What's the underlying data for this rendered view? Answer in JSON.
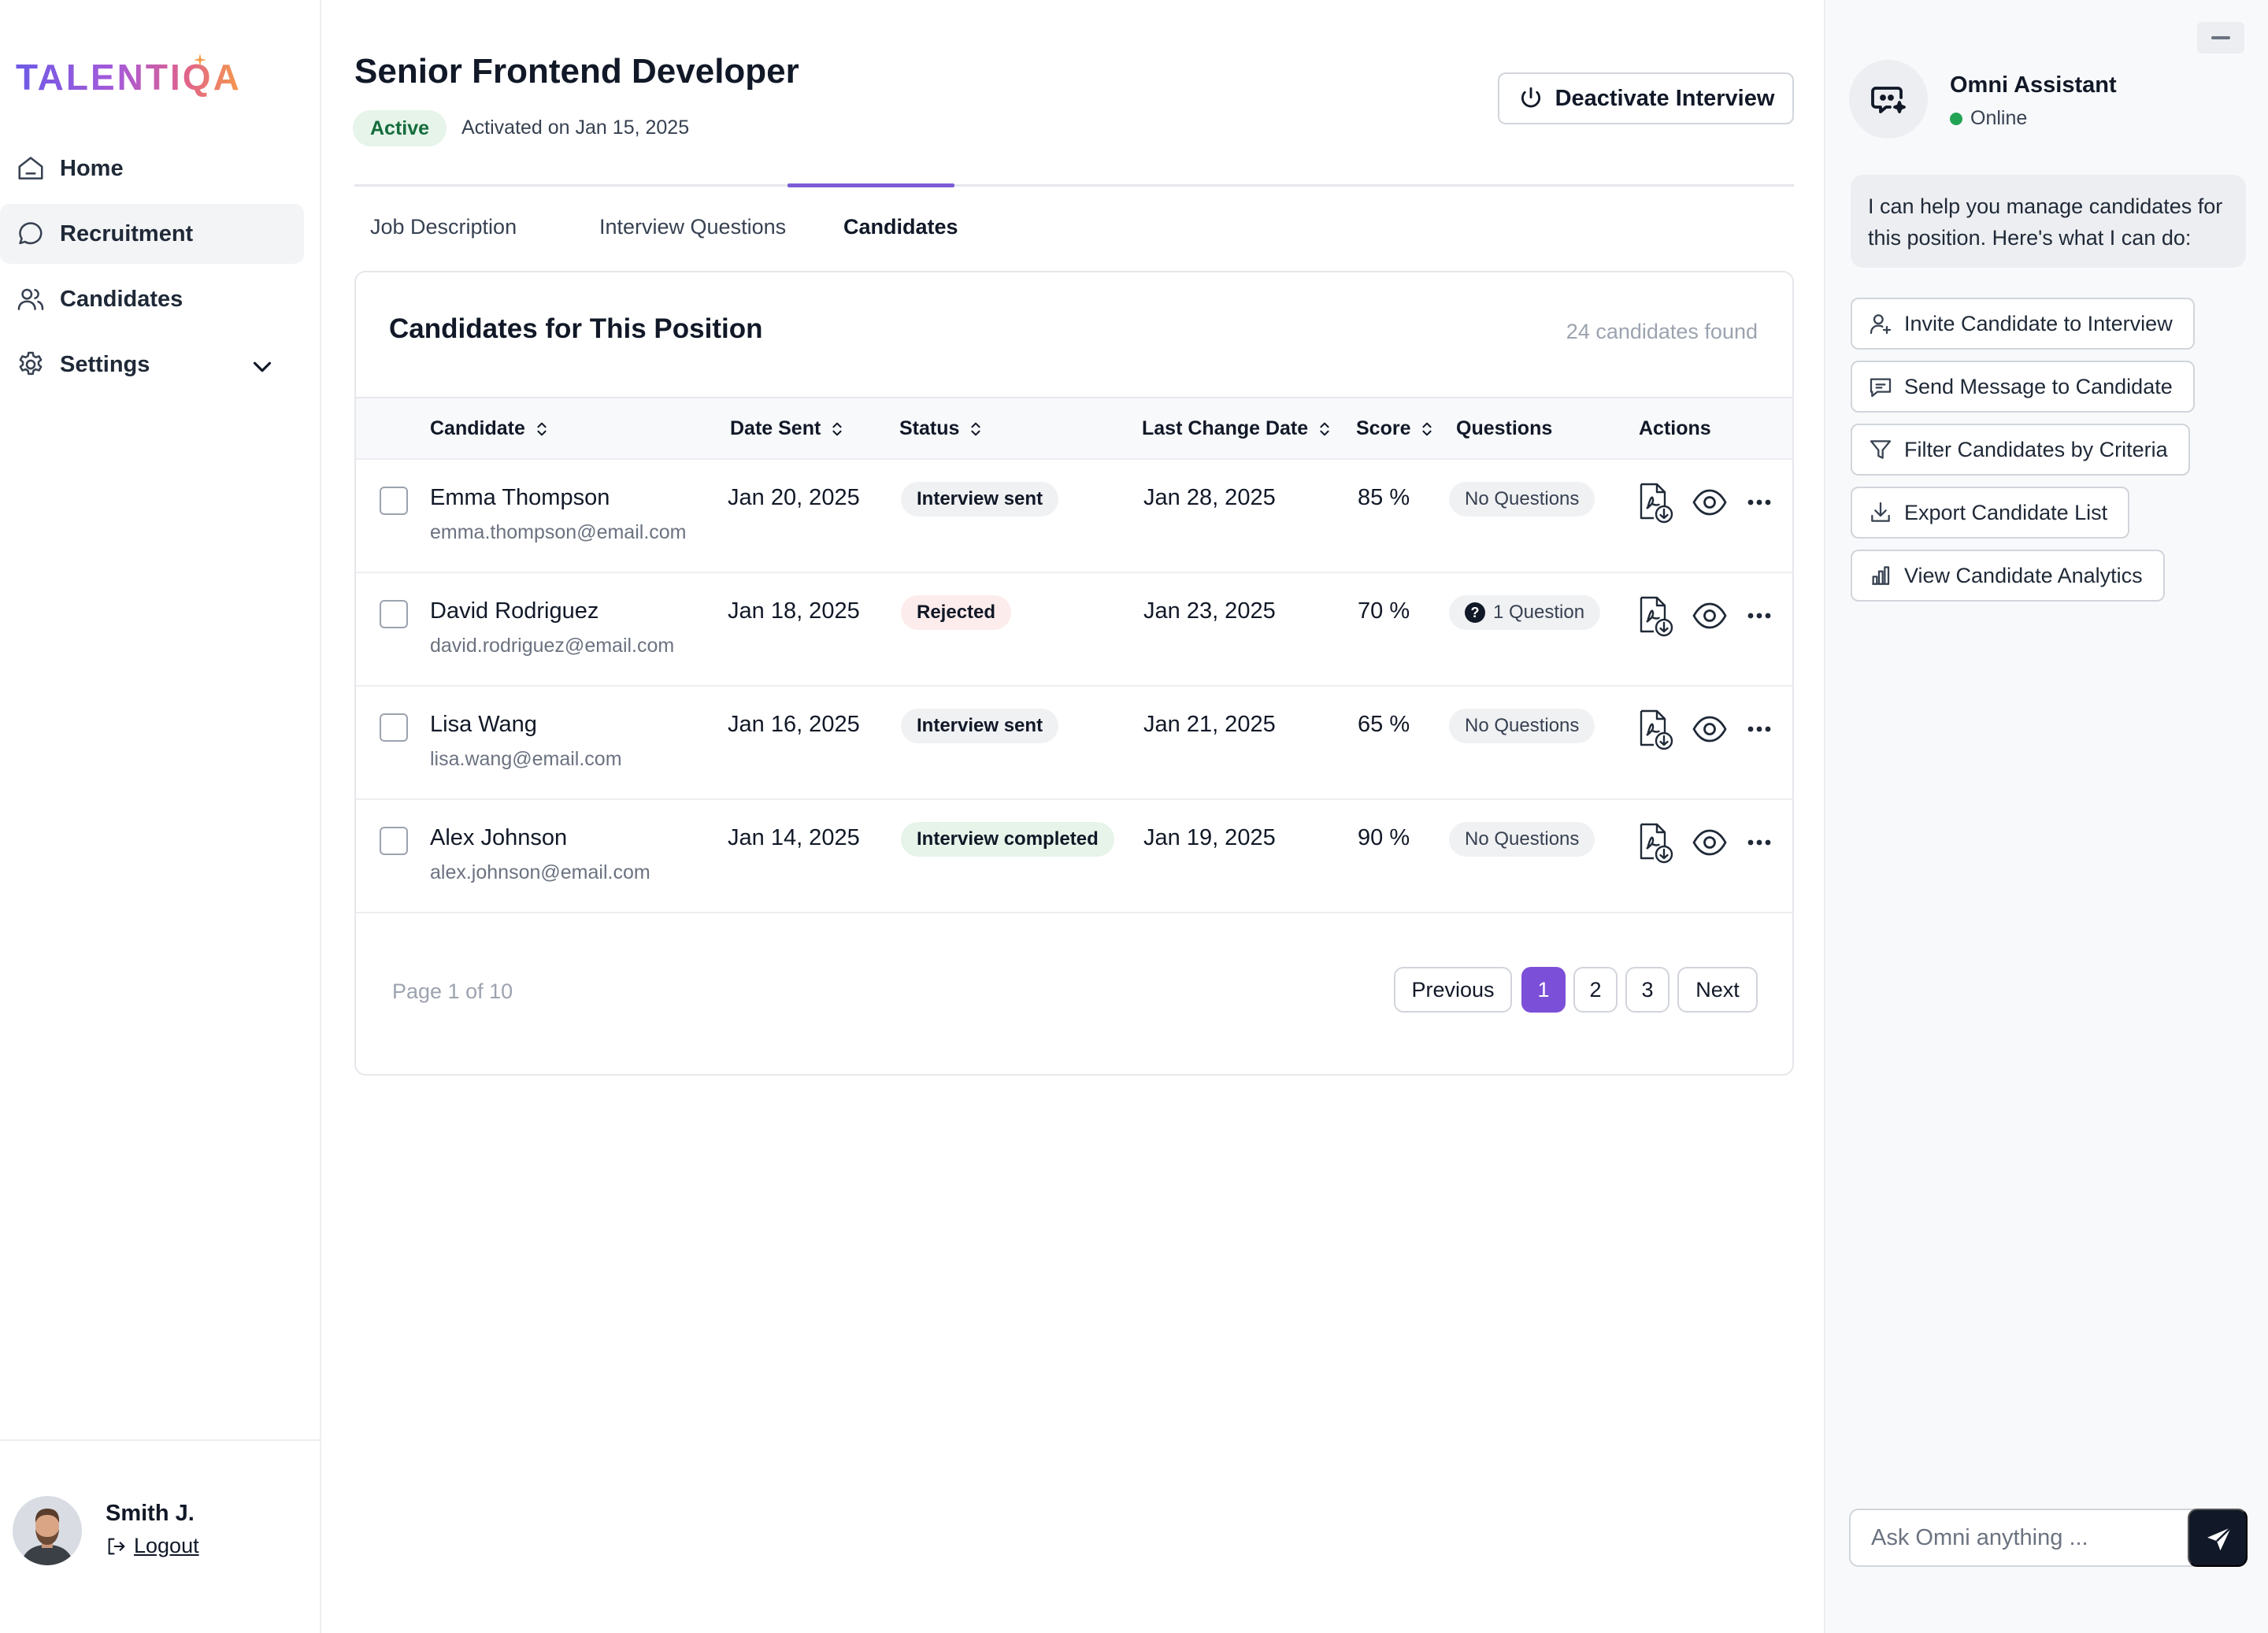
{
  "brand": {
    "logo_text": "TALENTIQA",
    "gradient": [
      "#6d5ae6",
      "#a75ad8",
      "#e0628c",
      "#f59a4a"
    ]
  },
  "sidebar": {
    "items": [
      {
        "label": "Home",
        "icon": "home-icon"
      },
      {
        "label": "Recruitment",
        "icon": "chat-bubble-icon",
        "active": true
      },
      {
        "label": "Candidates",
        "icon": "users-icon"
      },
      {
        "label": "Settings",
        "icon": "gear-icon",
        "expandable": true
      }
    ],
    "user": {
      "name": "Smith J.",
      "logout_label": "Logout"
    }
  },
  "header": {
    "title": "Senior Frontend Developer",
    "status_badge": "Active",
    "activated_text": "Activated on Jan 15, 2025",
    "deactivate_label": "Deactivate Interview"
  },
  "tabs": [
    {
      "label": "Job Description"
    },
    {
      "label": "Interview Questions"
    },
    {
      "label": "Candidates",
      "active": true
    }
  ],
  "candidates_card": {
    "title": "Candidates for This Position",
    "count_text": "24 candidates found",
    "columns": [
      "Candidate",
      "Date Sent",
      "Status",
      "Last Change Date",
      "Score",
      "Questions",
      "Actions"
    ],
    "rows": [
      {
        "name": "Emma Thompson",
        "email": "emma.thompson@email.com",
        "date_sent": "Jan 20, 2025",
        "status": "Interview sent",
        "status_color": "#f0f1f3",
        "last_change": "Jan 28, 2025",
        "score": "85 %",
        "questions": "No Questions"
      },
      {
        "name": "David Rodriguez",
        "email": "david.rodriguez@email.com",
        "date_sent": "Jan 18, 2025",
        "status": "Rejected",
        "status_color": "#fdecec",
        "last_change": "Jan 23, 2025",
        "score": "70 %",
        "questions": "1 Question",
        "questions_icon": "?"
      },
      {
        "name": "Lisa Wang",
        "email": "lisa.wang@email.com",
        "date_sent": "Jan 16, 2025",
        "status": "Interview sent",
        "status_color": "#f0f1f3",
        "last_change": "Jan 21, 2025",
        "score": "65 %",
        "questions": "No Questions"
      },
      {
        "name": "Alex Johnson",
        "email": "alex.johnson@email.com",
        "date_sent": "Jan 14, 2025",
        "status": "Interview completed",
        "status_color": "#e6f4ea",
        "last_change": "Jan 19, 2025",
        "score": "90 %",
        "questions": "No Questions"
      }
    ],
    "pagination": {
      "page_text": "Page 1 of 10",
      "previous_label": "Previous",
      "pages": [
        "1",
        "2",
        "3"
      ],
      "current_page": "1",
      "next_label": "Next"
    }
  },
  "assistant": {
    "name": "Omni Assistant",
    "status": "Online",
    "status_color": "#22a354",
    "message": "I can help you manage candidates for this position. Here's what I can do:",
    "actions": [
      {
        "label": "Invite Candidate to Interview",
        "icon": "user-plus-icon"
      },
      {
        "label": "Send Message to Candidate",
        "icon": "message-icon"
      },
      {
        "label": "Filter Candidates by Criteria",
        "icon": "filter-icon"
      },
      {
        "label": "Export Candidate List",
        "icon": "download-icon"
      },
      {
        "label": "View Candidate Analytics",
        "icon": "bar-chart-icon"
      }
    ],
    "input_placeholder": "Ask Omni anything ..."
  },
  "accent_color": "#7c4fd8"
}
